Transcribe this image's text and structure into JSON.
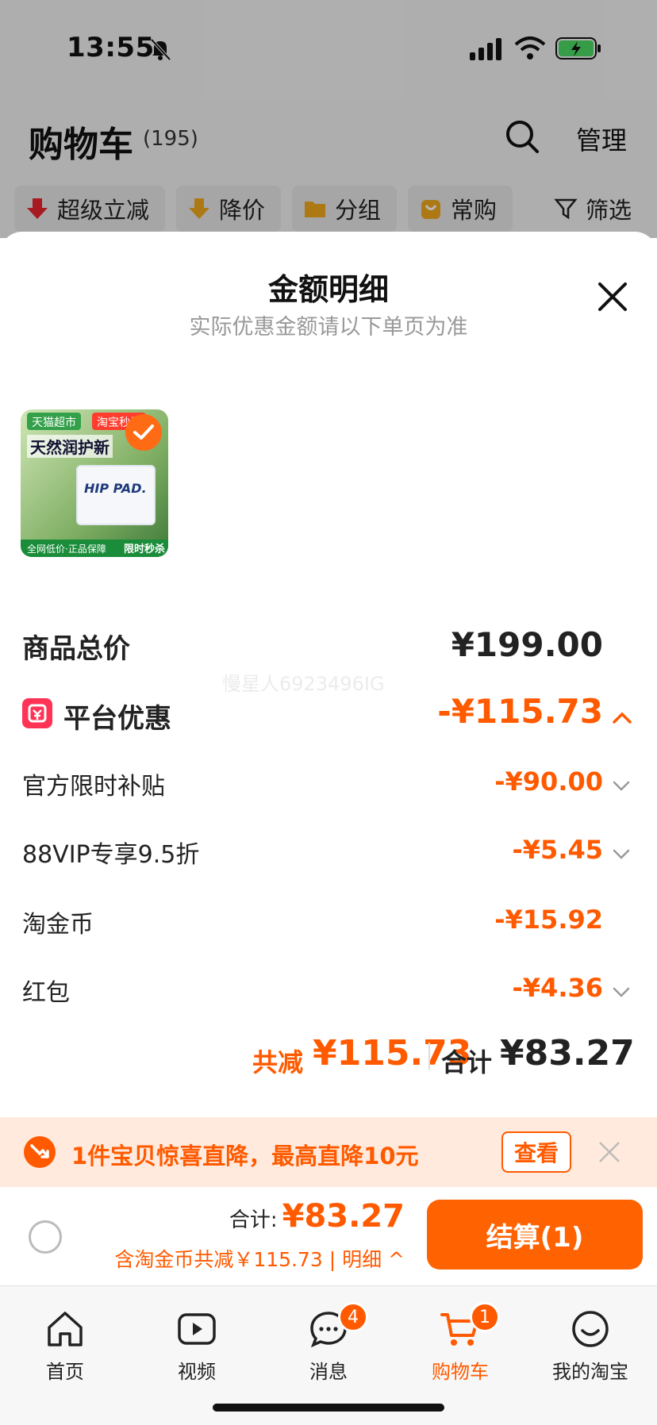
{
  "status_bar": {
    "time": "13:55"
  },
  "cart": {
    "title": "购物车",
    "count": "(195)",
    "manage_label": "管理",
    "filters": [
      {
        "label": "超级立减",
        "icon": "arrow-down-red-icon"
      },
      {
        "label": "降价",
        "icon": "price-down-icon"
      },
      {
        "label": "分组",
        "icon": "folder-icon"
      },
      {
        "label": "常购",
        "icon": "bag-icon"
      },
      {
        "label": "筛选",
        "icon": "filter-icon"
      }
    ]
  },
  "sheet": {
    "title": "金额明细",
    "subtitle": "实际优惠金额请以下单页为准",
    "product_thumb": {
      "tag_left": "天猫超市",
      "tag_right": "淘宝秒杀",
      "headline": "天然润护新",
      "box_label": "HIP PAD.",
      "bottom_left": "全网低价·正品保障",
      "bottom_right": "限时秒杀"
    },
    "rows": {
      "goods_total": {
        "label": "商品总价",
        "value": "¥199.00"
      },
      "platform_discount": {
        "label": "平台优惠",
        "value": "-¥115.73"
      },
      "official_subsidy": {
        "label": "官方限时补贴",
        "value": "-¥90.00"
      },
      "vip_discount": {
        "label": "88VIP专享9.5折",
        "value": "-¥5.45"
      },
      "gold_coins": {
        "label": "淘金币",
        "value": "-¥15.92"
      },
      "red_packet": {
        "label": "红包",
        "value": "-¥4.36"
      }
    },
    "summary": {
      "saved_label": "共减",
      "saved_value": "¥115.73",
      "total_label": "合计",
      "total_value": "¥83.27"
    },
    "watermark": "慢星人6923496IG"
  },
  "promo": {
    "text": "1件宝贝惊喜直降，最高直降10元",
    "button_label": "查看"
  },
  "checkout": {
    "total_label": "合计:",
    "total_value": "¥83.27",
    "note": "含淘金币共减￥115.73 | 明细 ^",
    "button_label": "结算(1)"
  },
  "tabbar": {
    "tabs": [
      {
        "label": "首页",
        "icon": "home-icon"
      },
      {
        "label": "视频",
        "icon": "video-icon"
      },
      {
        "label": "消息",
        "icon": "message-icon",
        "badge": "4"
      },
      {
        "label": "购物车",
        "icon": "cart-icon",
        "badge": "1"
      },
      {
        "label": "我的淘宝",
        "icon": "profile-icon"
      }
    ]
  },
  "colors": {
    "accent": "#ff5a00",
    "checkout_button": "#ff6200",
    "promo_bg": "#ffeadd"
  }
}
